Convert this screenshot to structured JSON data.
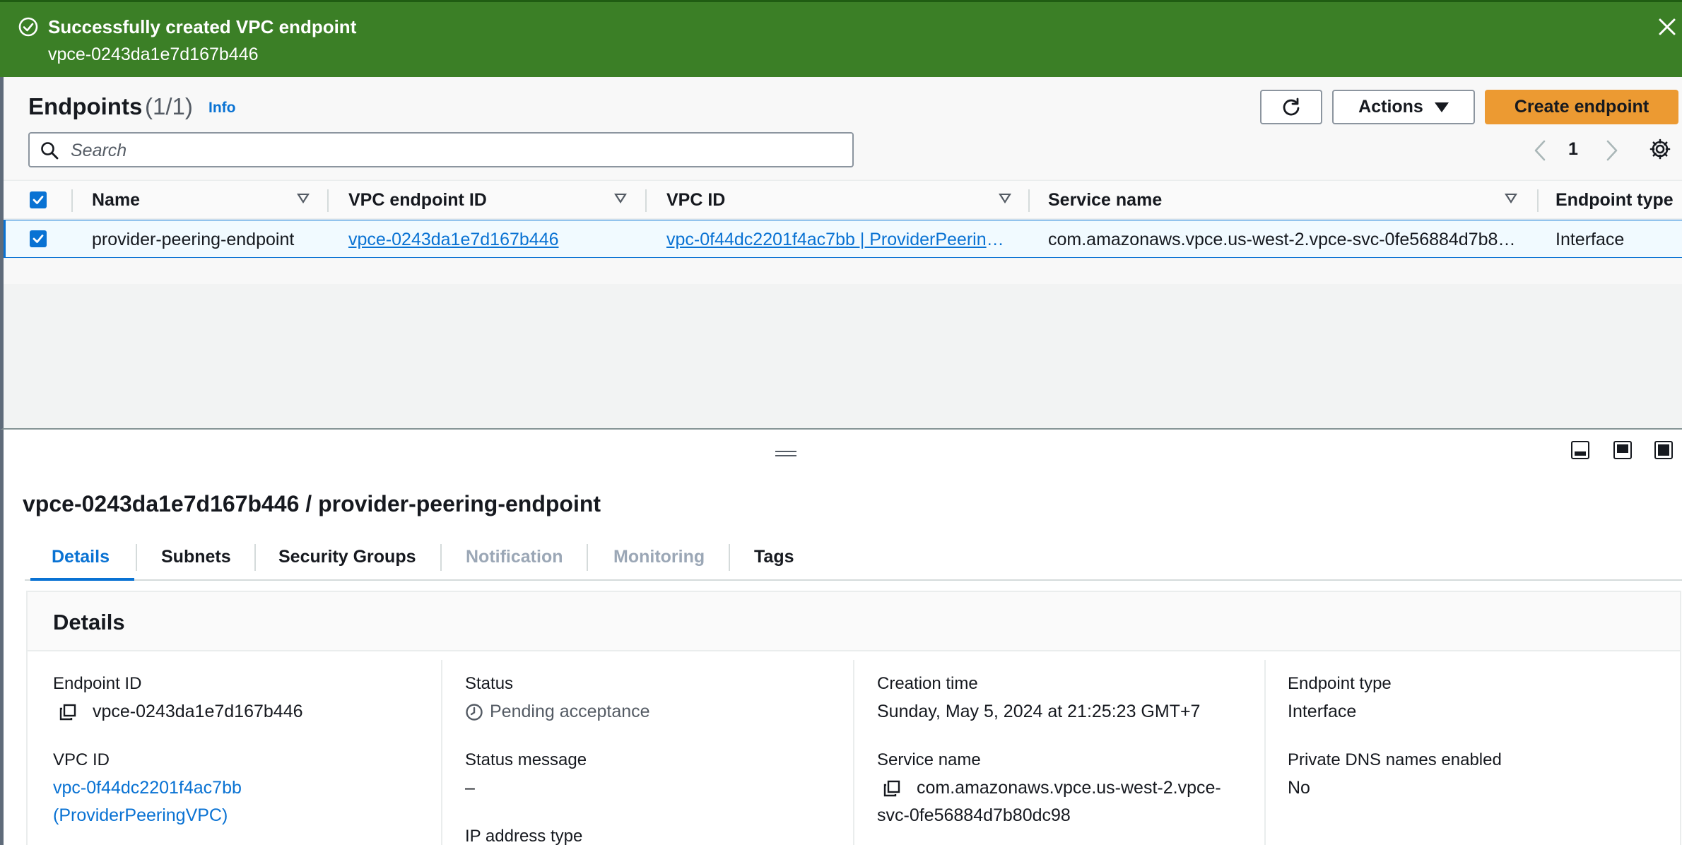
{
  "flash": {
    "title": "Successfully created VPC endpoint",
    "message": "vpce-0243da1e7d167b446"
  },
  "list": {
    "title": "Endpoints",
    "count": "(1/1)",
    "info_label": "Info",
    "actions_label": "Actions",
    "create_label": "Create endpoint",
    "search_placeholder": "Search",
    "current_page": "1",
    "columns": [
      "Name",
      "VPC endpoint ID",
      "VPC ID",
      "Service name",
      "Endpoint type"
    ],
    "rows": [
      {
        "name": "provider-peering-endpoint",
        "endpoint_id": "vpce-0243da1e7d167b446",
        "vpc_id": "vpc-0f44dc2201f4ac7bb | ProviderPeeringVPC",
        "service_name": "com.amazonaws.vpce.us-west-2.vpce-svc-0fe56884d7b80dc98",
        "endpoint_type": "Interface"
      }
    ]
  },
  "panel": {
    "title": "vpce-0243da1e7d167b446 / provider-peering-endpoint",
    "tabs": [
      "Details",
      "Subnets",
      "Security Groups",
      "Notification",
      "Monitoring",
      "Tags"
    ],
    "section_title": "Details",
    "fields": {
      "endpoint_id_label": "Endpoint ID",
      "endpoint_id_value": "vpce-0243da1e7d167b446",
      "vpc_id_label": "VPC ID",
      "vpc_id_value_line1": "vpc-0f44dc2201f4ac7bb",
      "vpc_id_value_line2": "(ProviderPeeringVPC)",
      "status_label": "Status",
      "status_value": "Pending acceptance",
      "status_message_label": "Status message",
      "status_message_value": "–",
      "ip_type_label": "IP address type",
      "creation_time_label": "Creation time",
      "creation_time_value": "Sunday, May 5, 2024 at 21:25:23 GMT+7",
      "service_name_label": "Service name",
      "service_name_line1": "com.amazonaws.vpce.us-west-2.vpce-",
      "service_name_line2": "svc-0fe56884d7b80dc98",
      "endpoint_type_label": "Endpoint type",
      "endpoint_type_value": "Interface",
      "private_dns_label": "Private DNS names enabled",
      "private_dns_value": "No"
    }
  },
  "colors": {
    "flash_bg": "#3b7f26",
    "primary_button": "#ec9a32",
    "link": "#0972d3",
    "disabled_tab": "#9ba7b6"
  }
}
